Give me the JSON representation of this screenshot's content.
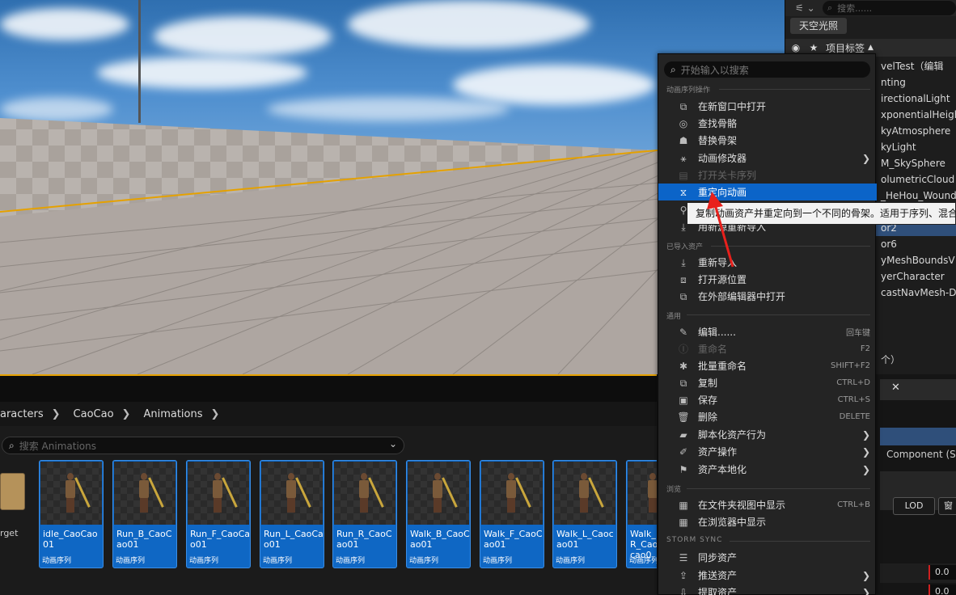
{
  "outliner": {
    "sky_button": "天空光照",
    "column_label": "项目标签",
    "search_placeholder": "搜索......",
    "rows": [
      "velTest（编辑",
      "nting",
      "irectionalLight",
      "xponentialHeigh",
      "kyAtmosphere",
      "kyLight",
      "M_SkySphere",
      "olumetricCloud",
      "_HeHou_Wound",
      "",
      "or2",
      "or6",
      "yMeshBoundsV",
      "yerCharacter",
      "castNavMesh-D"
    ],
    "count_text": "个）"
  },
  "details": {
    "component": "Component (St",
    "lod_label": "LOD",
    "lod2_label": "窗",
    "field1": "0.0",
    "field2": "0.0"
  },
  "breadcrumb": [
    "aracters",
    "CaoCao",
    "Animations"
  ],
  "content_browser": {
    "search_placeholder": "搜索 Animations",
    "folder_label": "rget",
    "assets": [
      {
        "name": "idle_CaoCao01",
        "type": "动画序列"
      },
      {
        "name": "Run_B_CaoCao01",
        "type": "动画序列"
      },
      {
        "name": "Run_F_CaoCao01",
        "type": "动画序列"
      },
      {
        "name": "Run_L_CaoCao01",
        "type": "动画序列"
      },
      {
        "name": "Run_R_CaoCao01",
        "type": "动画序列"
      },
      {
        "name": "Walk_B_CaoCao01",
        "type": "动画序列"
      },
      {
        "name": "Walk_F_CaoCao01",
        "type": "动画序列"
      },
      {
        "name": "Walk_L_Caocao01",
        "type": "动画序列"
      },
      {
        "name": "Walk_R_Caocao0",
        "type": "动画序列"
      }
    ]
  },
  "context_menu": {
    "search_placeholder": "开始输入以搜索",
    "sections": {
      "anim_seq": "动画序列操作",
      "imported": "已导入资产",
      "common": "通用",
      "browse": "浏览",
      "storm": "STORM SYNC"
    },
    "items": {
      "open_new_window": "在新窗口中打开",
      "find_skeleton": "查找骨骼",
      "replace_skeleton": "替换骨架",
      "anim_modifiers": "动画修改器",
      "open_level_seq": "打开关卡序列",
      "retarget": "重定向动画",
      "reimport_new": "用新源重新导入",
      "reimport": "重新导入",
      "open_source": "打开源位置",
      "open_external": "在外部编辑器中打开",
      "edit": "编辑......",
      "rename": "重命名",
      "batch_rename": "批量重命名",
      "duplicate": "复制",
      "save": "保存",
      "delete": "删除",
      "scripted_actions": "脚本化资产行为",
      "asset_actions": "资产操作",
      "localize": "资产本地化",
      "show_in_folder": "在文件夹视图中显示",
      "show_in_browser": "在浏览器中显示",
      "sync_assets": "同步资产",
      "push_assets": "推送资产",
      "pull_assets": "提取资产"
    },
    "shortcuts": {
      "edit": "回车键",
      "rename": "F2",
      "batch_rename": "SHIFT+F2",
      "duplicate": "CTRL+D",
      "save": "CTRL+S",
      "delete": "DELETE",
      "show_in_folder": "CTRL+B"
    }
  },
  "tooltip": "复制动画资产并重定向到一个不同的骨架。适用于序列、混合空间",
  "colors": {
    "highlight": "#0b64c8",
    "arrow": "#e8201c",
    "tile": "#0f67c4",
    "orange_line": "#e5a100"
  }
}
